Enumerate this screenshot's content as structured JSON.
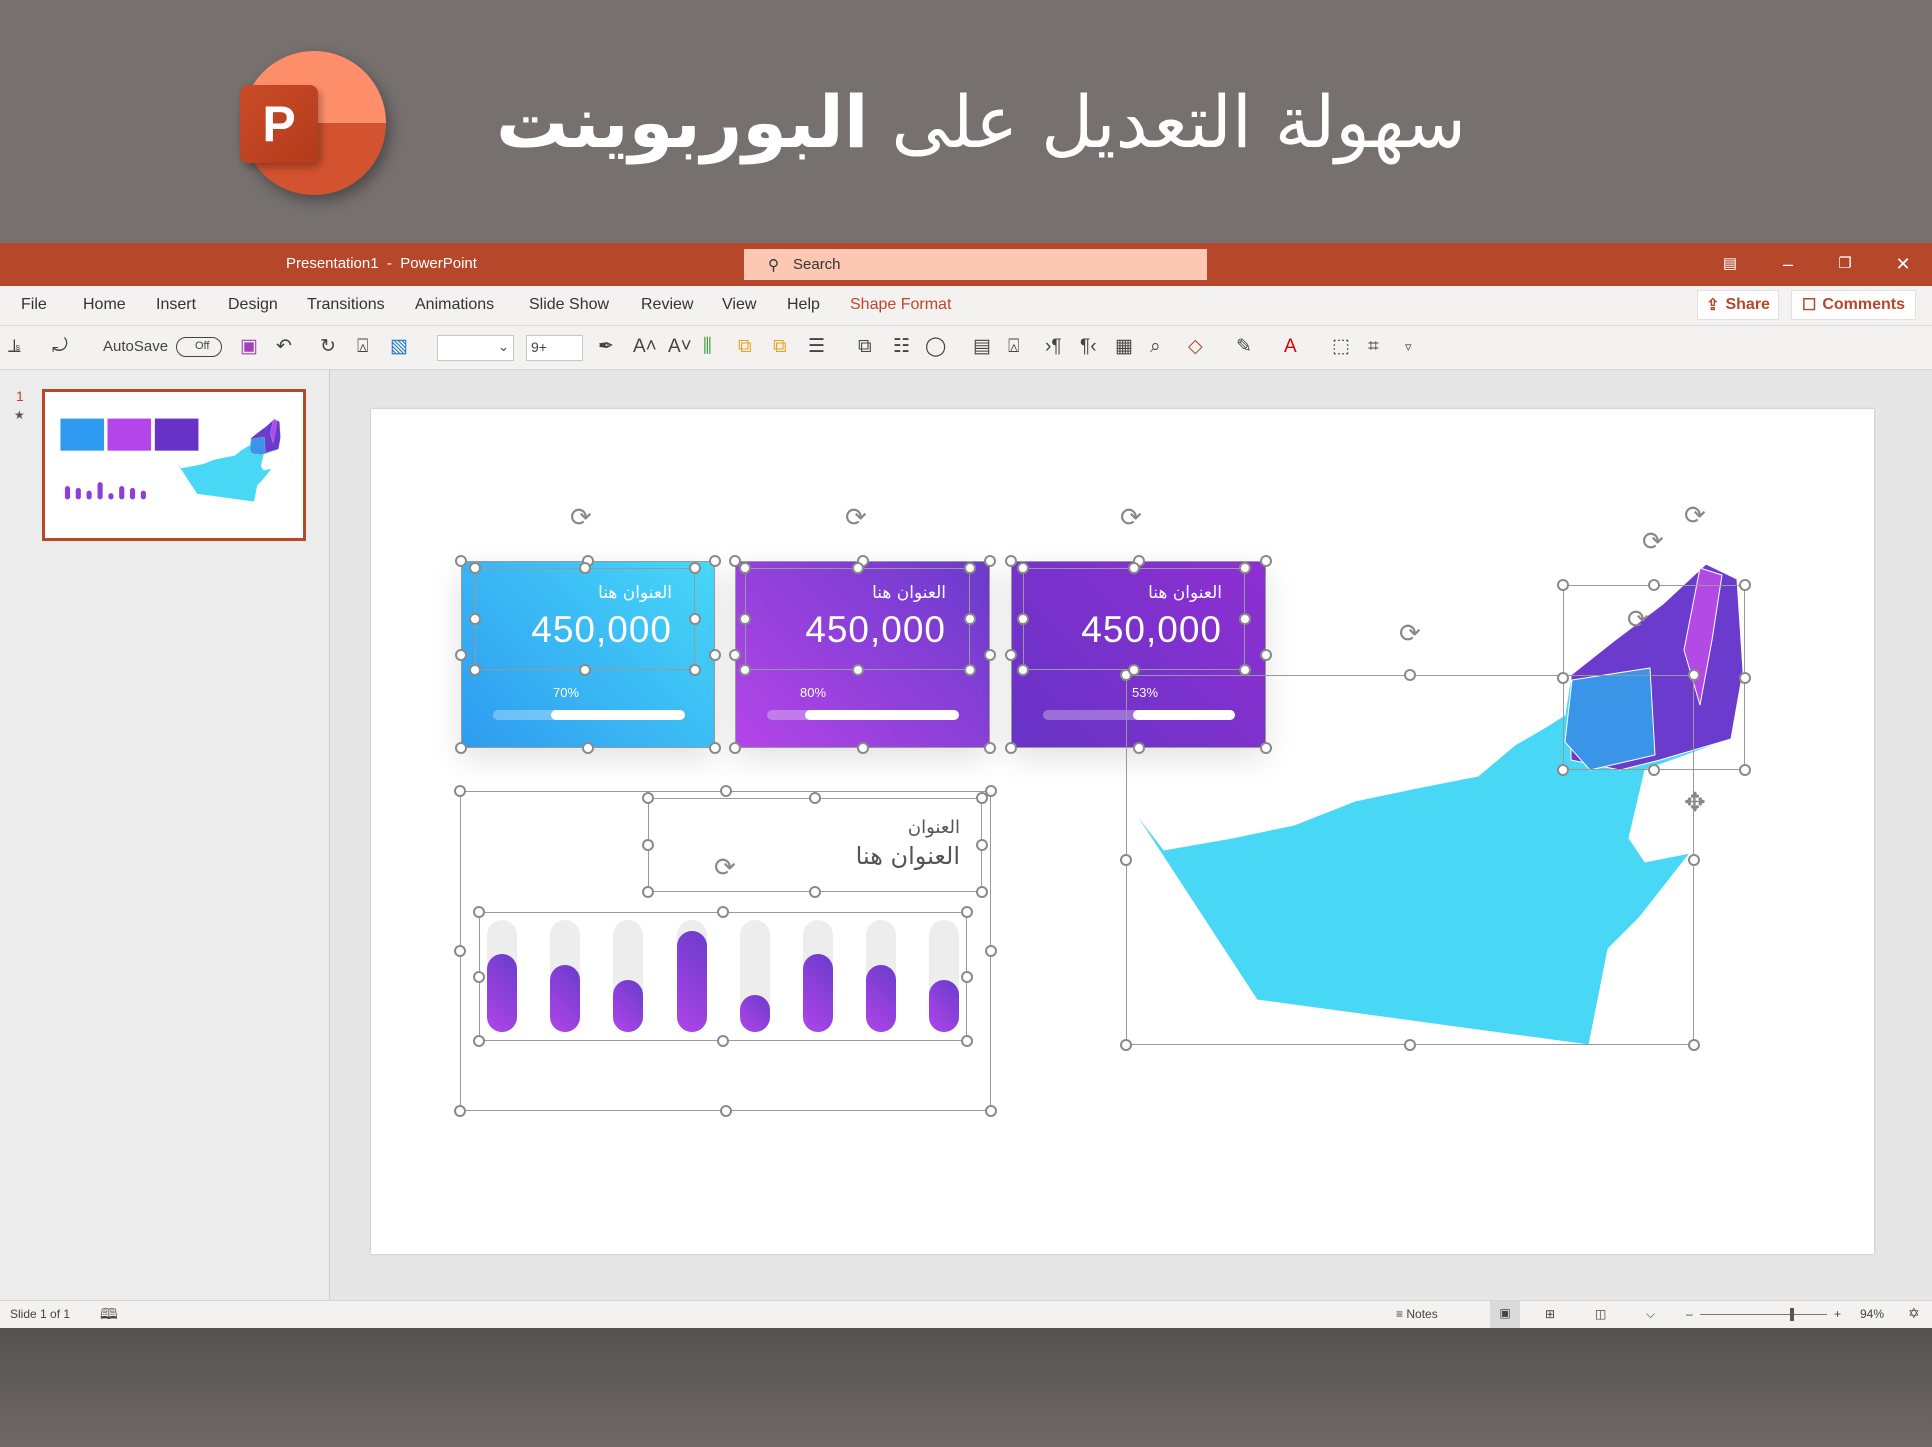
{
  "banner": {
    "title_part1": "سهولة التعديل على ",
    "title_bold": "البوربوينت",
    "logo_letter": "P"
  },
  "titlebar": {
    "title": "Presentation1  -  PowerPoint",
    "search_placeholder": "Search",
    "controls": [
      "ribbon-display-icon",
      "minimize-icon",
      "restore-icon",
      "close-icon"
    ]
  },
  "tabs": [
    "File",
    "Home",
    "Insert",
    "Design",
    "Transitions",
    "Animations",
    "Slide Show",
    "Review",
    "View",
    "Help",
    "Shape Format"
  ],
  "active_tab": "Shape Format",
  "share_label": "Share",
  "comments_label": "Comments",
  "toolbar": {
    "autosave_label": "AutoSave",
    "autosave_state": "Off",
    "font_name": "",
    "font_size": "9+",
    "icons": [
      "align-icon",
      "rotate-icon",
      "save-icon",
      "undo-icon",
      "redo-icon",
      "present-icon",
      "color-icon",
      "format-painter-icon",
      "grow-font-icon",
      "shrink-font-icon",
      "text-align-icon",
      "bring-forward-icon",
      "send-backward-icon",
      "bullets-icon",
      "arrange-icon",
      "group-icon",
      "shapes-icon",
      "text-box-icon",
      "presenter-icon",
      "ltr-icon",
      "rtl-icon",
      "reuse-icon",
      "find-icon",
      "shape-fill-icon",
      "shape-outline-icon",
      "font-color-icon",
      "selection-pane-icon",
      "crop-icon",
      "customize-icon"
    ]
  },
  "slide_panel": {
    "number": "1"
  },
  "cards": [
    {
      "title": "العنوان هنا",
      "value": "450,000",
      "percent_label": "70%",
      "percent": 70,
      "colors": [
        "#2e9bf0",
        "#47d8f8"
      ]
    },
    {
      "title": "العنوان هنا",
      "value": "450,000",
      "percent_label": "80%",
      "percent": 80,
      "colors": [
        "#b445e8",
        "#6a3bcc"
      ]
    },
    {
      "title": "العنوان هنا",
      "value": "450,000",
      "percent_label": "53%",
      "percent": 53,
      "colors": [
        "#6733c6",
        "#8e30d2"
      ]
    }
  ],
  "chart": {
    "subtitle": "العنوان",
    "title": "العنوان هنا"
  },
  "chart_data": {
    "type": "bar",
    "values_percent": [
      70,
      60,
      46,
      90,
      33,
      70,
      60,
      46
    ],
    "track_color": "#ededed",
    "bar_colors": [
      "#b045e8",
      "#6a3bcc"
    ]
  },
  "map": {
    "main_color": "#48d8f6",
    "region_colors": [
      "#6a3bcc",
      "#3a95e8",
      "#b44ae6"
    ]
  },
  "status": {
    "slide_info": "Slide 1 of 1",
    "notes_label": "Notes",
    "zoom": "94%",
    "zoom_percent": 94
  },
  "colors": {
    "accent": "#b7472a"
  }
}
